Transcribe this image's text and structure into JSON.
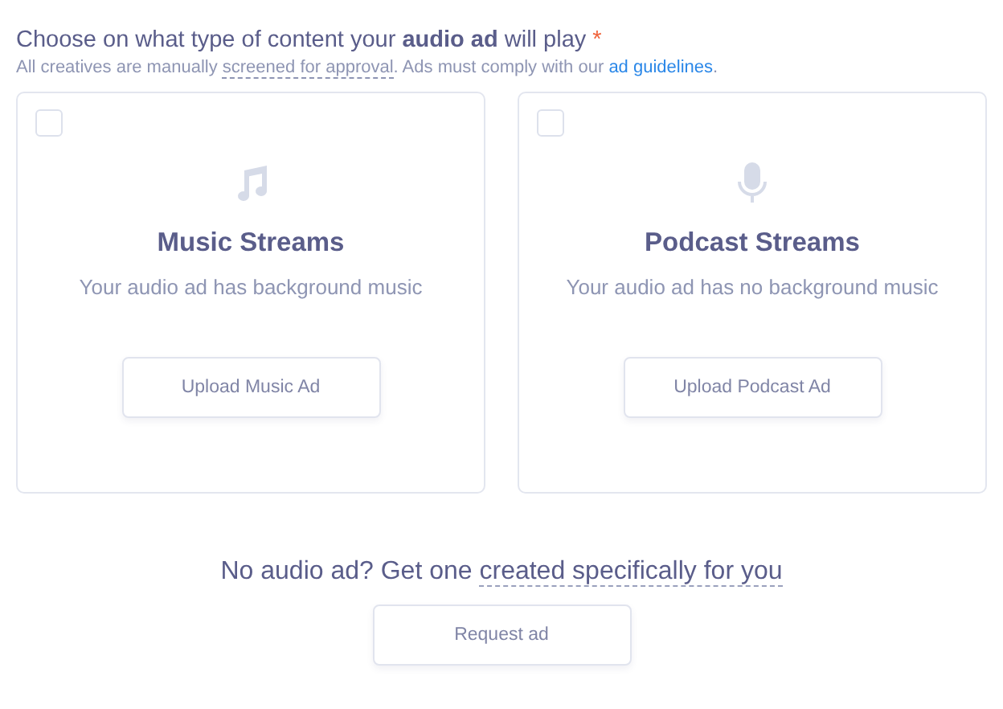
{
  "heading": {
    "text": "Choose on what type of content your **audio ad** will play",
    "required_mark": "*"
  },
  "note": {
    "before": "All creatives are manually ",
    "tooltip": "screened for approval",
    "middle": ". Ads must comply with our ",
    "link": "ad guidelines",
    "after": "."
  },
  "options": [
    {
      "kind": "music",
      "checked": false,
      "title": "Music Streams",
      "description": "Your audio ad has background music",
      "button": "Upload Music Ad"
    },
    {
      "kind": "podcast",
      "checked": false,
      "title": "Podcast Streams",
      "description": "Your audio ad has no background music",
      "button": "Upload Podcast Ad"
    }
  ],
  "footer": {
    "text": "No audio ad? Get one ",
    "tooltip": "created specifically for you",
    "button": "Request ad"
  }
}
